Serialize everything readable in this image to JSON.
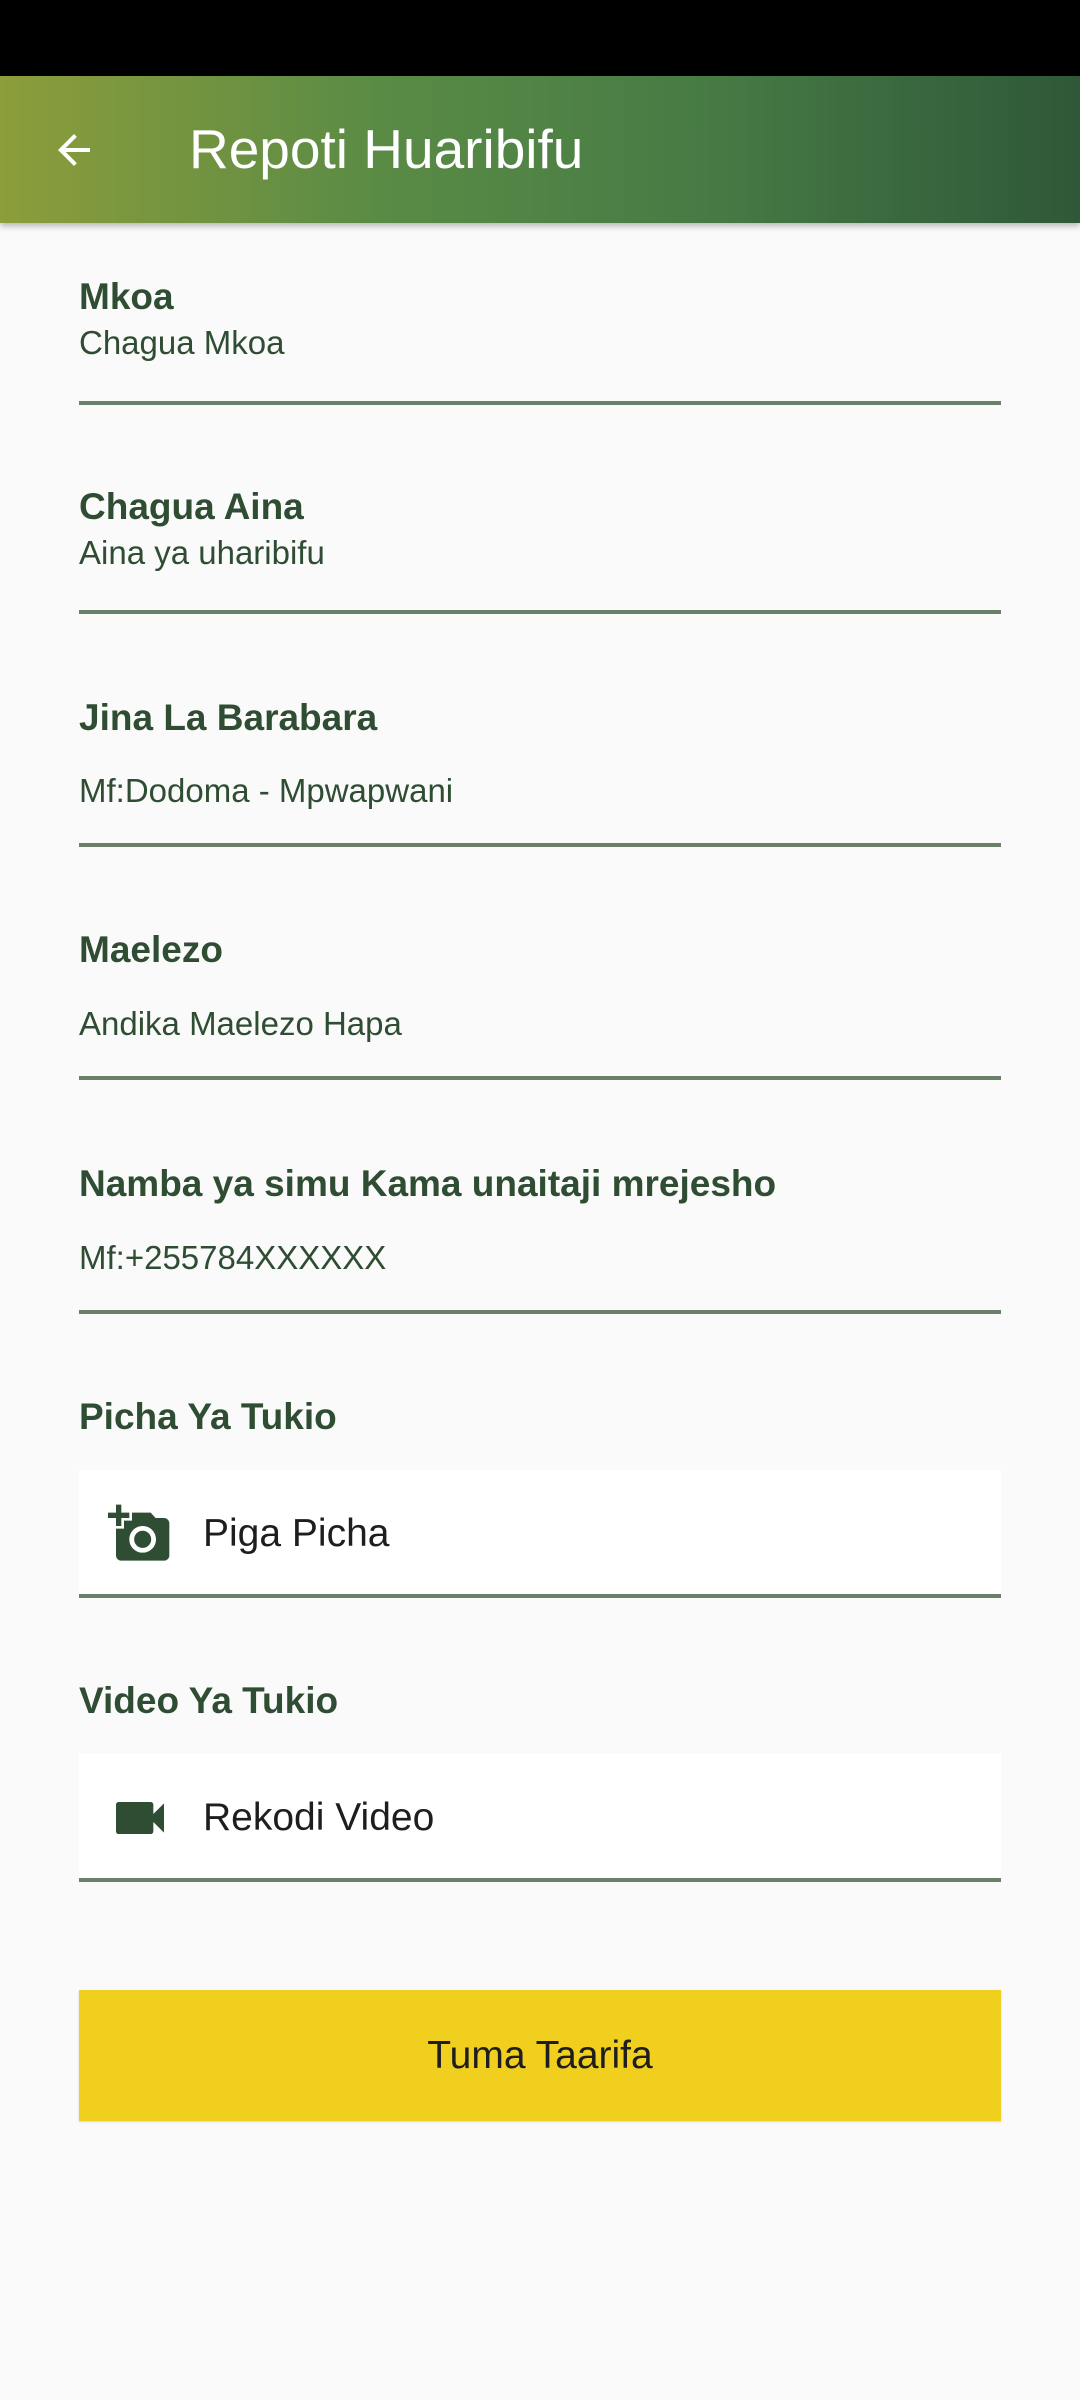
{
  "app_bar": {
    "title": "Repoti Huaribifu"
  },
  "form": {
    "region": {
      "label": "Mkoa",
      "value": "Chagua Mkoa"
    },
    "type": {
      "label": "Chagua Aina",
      "value": "Aina ya uharibifu"
    },
    "road": {
      "label": "Jina La Barabara",
      "placeholder": "Mf:Dodoma - Mpwapwani"
    },
    "description": {
      "label": "Maelezo",
      "placeholder": "Andika Maelezo Hapa"
    },
    "phone": {
      "label": "Namba ya simu Kama unaitaji mrejesho",
      "placeholder": "Mf:+255784XXXXXX"
    },
    "photo": {
      "label": "Picha Ya Tukio",
      "button": "Piga Picha",
      "icon": "add-a-photo-icon"
    },
    "video": {
      "label": "Video Ya Tukio",
      "button": "Rekodi Video",
      "icon": "videocam-icon"
    }
  },
  "submit": {
    "label": "Tuma Taarifa"
  },
  "colors": {
    "accent": "#f0cf1e",
    "text_green": "#2f4d33",
    "underline": "#6b806b"
  }
}
